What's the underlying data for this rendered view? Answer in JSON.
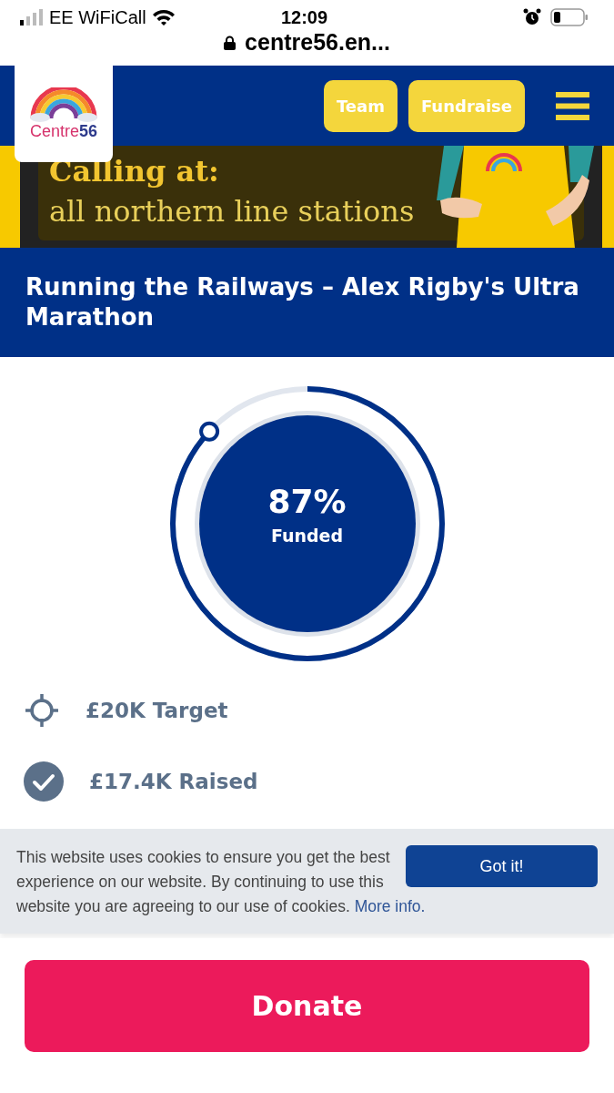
{
  "status_bar": {
    "carrier": "EE WiFiCall",
    "time": "12:09",
    "url": "centre56.en..."
  },
  "header": {
    "logo_text": "Centre",
    "logo_number": "56",
    "buttons": [
      "Team",
      "Fundraise"
    ]
  },
  "banner": {
    "heading": "Calling at:",
    "subheading": "all northern line stations"
  },
  "title": "Running the Railways – Alex Rigby's Ultra Marathon",
  "progress": {
    "level": 0.87,
    "percent": "87%",
    "label": "Funded"
  },
  "stats": [
    {
      "kind": "target",
      "text": "£20K Target"
    },
    {
      "kind": "raised",
      "text": "£17.4K Raised"
    }
  ],
  "cookie_banner": {
    "message": "This website uses cookies to ensure you get the best experience on our website. By continuing to use this website you are agreeing to our use of cookies.",
    "link": "More info.",
    "button": "Got it!"
  },
  "donate_button": "Donate"
}
